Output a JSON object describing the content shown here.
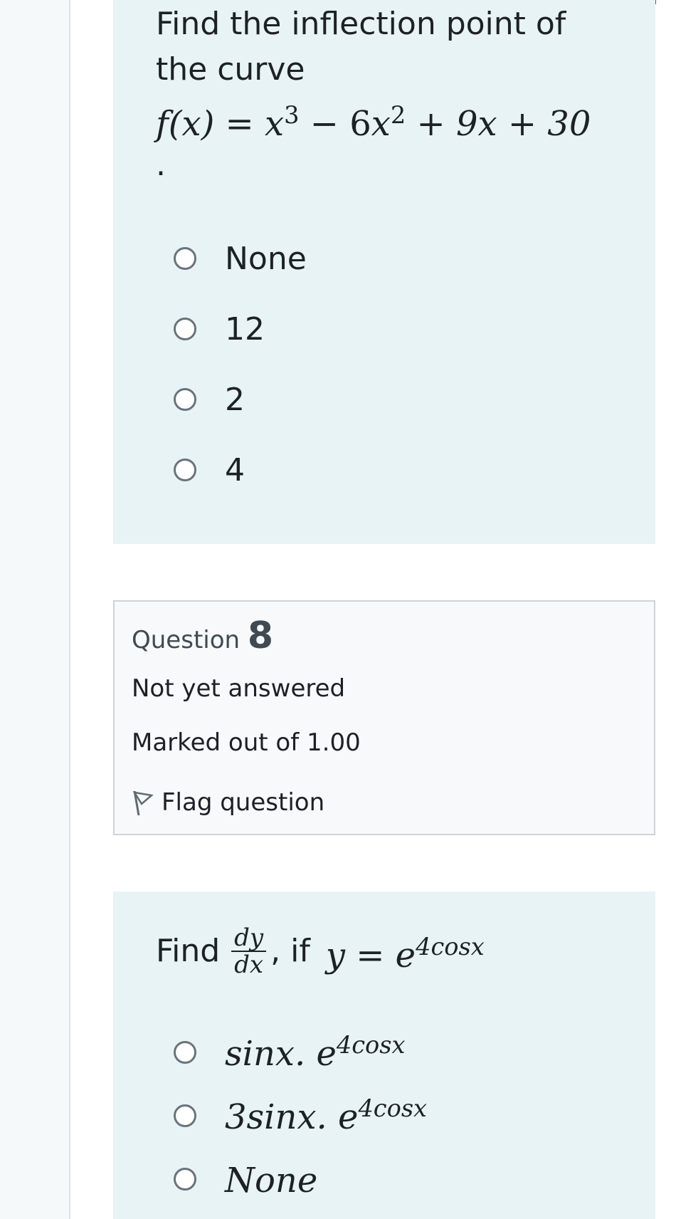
{
  "question7": {
    "text_line1": "Find the inflection point of",
    "text_line2": "the curve",
    "formula": {
      "lhs": "f(x) = ",
      "t1": "x",
      "t1_exp": "3",
      "minus": " − 6",
      "t2": "x",
      "t2_exp": "2",
      "rest": " + 9x + 30"
    },
    "period": ".",
    "options": [
      "None",
      "12",
      "2",
      "4"
    ]
  },
  "question8": {
    "label": "Question",
    "number": "8",
    "status": "Not yet answered",
    "marks": "Marked out of 1.00",
    "flag_label": "Flag question",
    "text_find": "Find",
    "frac_num": "dy",
    "frac_den": "dx",
    "text_if": ", if",
    "eq_lhs": "y = e",
    "eq_exp": "4cosx",
    "options": [
      {
        "base": "sinx. e",
        "exp": "4cosx"
      },
      {
        "base": "3sinx. e",
        "exp": "4cosx"
      },
      {
        "base": "None",
        "exp": ""
      }
    ]
  },
  "colors": {
    "question_bg": "#e7f3f5",
    "info_bg": "#f7f9fa",
    "info_border": "#cfd4d8",
    "highlight_border": "#b43c3c"
  },
  "icons": {
    "radio": "radio-unchecked-icon",
    "flag": "flag-outline-icon"
  }
}
